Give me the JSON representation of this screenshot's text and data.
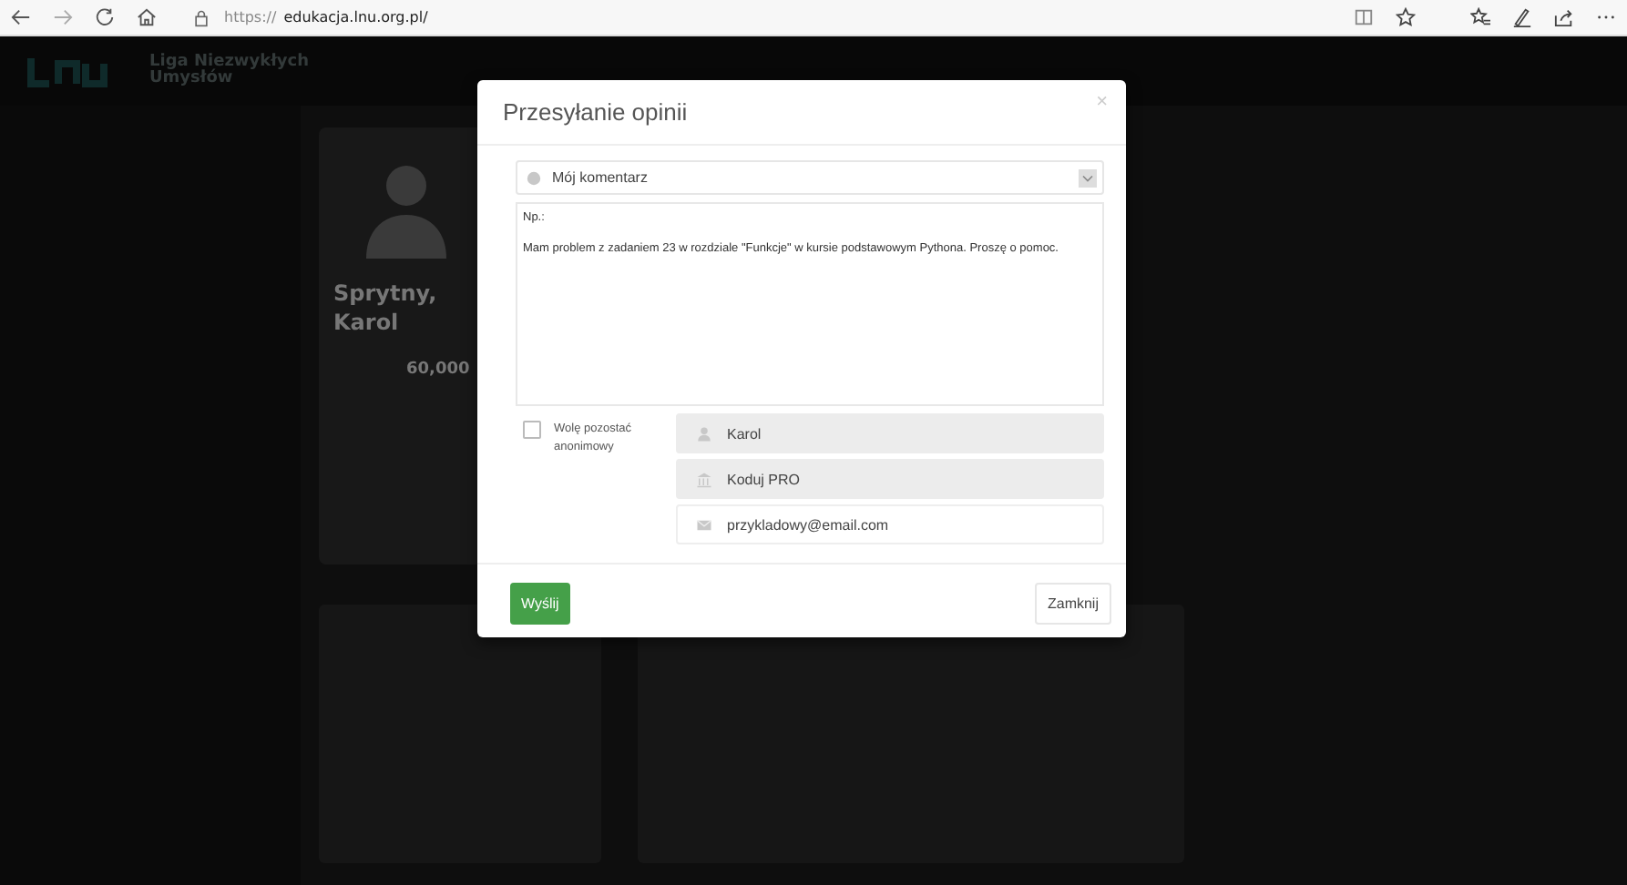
{
  "browser": {
    "url_prefix": "https://",
    "url_host": "edukacja.lnu.org.pl/"
  },
  "site": {
    "name": "Liga Niezwykłych Umysłów"
  },
  "profile_card": {
    "surname": "Sprytny,",
    "first_name": "Karol",
    "points": "60,000"
  },
  "dialog": {
    "title": "Przesyłanie opinii",
    "close": "×",
    "category": "Mój komentarz",
    "message": [
      "Np.:",
      "Mam problem z zadaniem 23 w rozdziale \"Funkcje\" w kursie podstawowym Pythona. Proszę o pomoc."
    ],
    "anonymous": {
      "label": "Wolę pozostać anonimowy",
      "checked": false
    },
    "fields": [
      {
        "kind": "person",
        "value": "Karol",
        "disabled": true
      },
      {
        "kind": "school",
        "value": "Koduj PRO",
        "disabled": true
      },
      {
        "kind": "email",
        "value": "przykladowy@email.com",
        "disabled": false
      }
    ],
    "submit": "Wyślij",
    "cancel": "Zamknij"
  }
}
